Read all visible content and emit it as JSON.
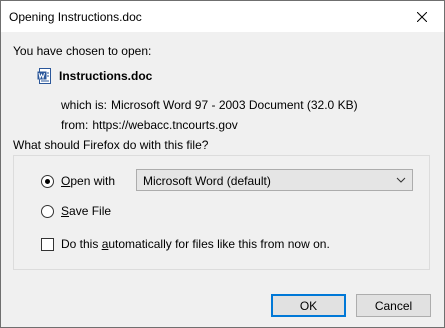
{
  "window": {
    "title": "Opening Instructions.doc",
    "close_icon": "close-icon"
  },
  "dialog": {
    "intro": "You have chosen to open:",
    "file_icon": "word-document-icon",
    "file_name": "Instructions.doc",
    "which_is_label": "which is:",
    "which_is_value": "Microsoft Word 97 - 2003 Document (32.0 KB)",
    "from_label": "from:",
    "from_value": "https://webacc.tncourts.gov"
  },
  "options": {
    "group_title": "What should Firefox do with this file?",
    "open_with_label_accel": "O",
    "open_with_label_rest": "pen with",
    "open_with_selected": true,
    "open_with_app": "Microsoft Word (default)",
    "save_file_label_accel": "S",
    "save_file_label_rest": "ave File",
    "save_file_selected": false,
    "auto_label_pre": "Do this ",
    "auto_label_accel": "a",
    "auto_label_post": "utomatically for files like this from now on.",
    "auto_checked": false
  },
  "buttons": {
    "ok": "OK",
    "cancel": "Cancel"
  },
  "colors": {
    "dialog_bg": "#f0f0f0",
    "title_bg": "#ffffff",
    "accent": "#0078d7"
  }
}
